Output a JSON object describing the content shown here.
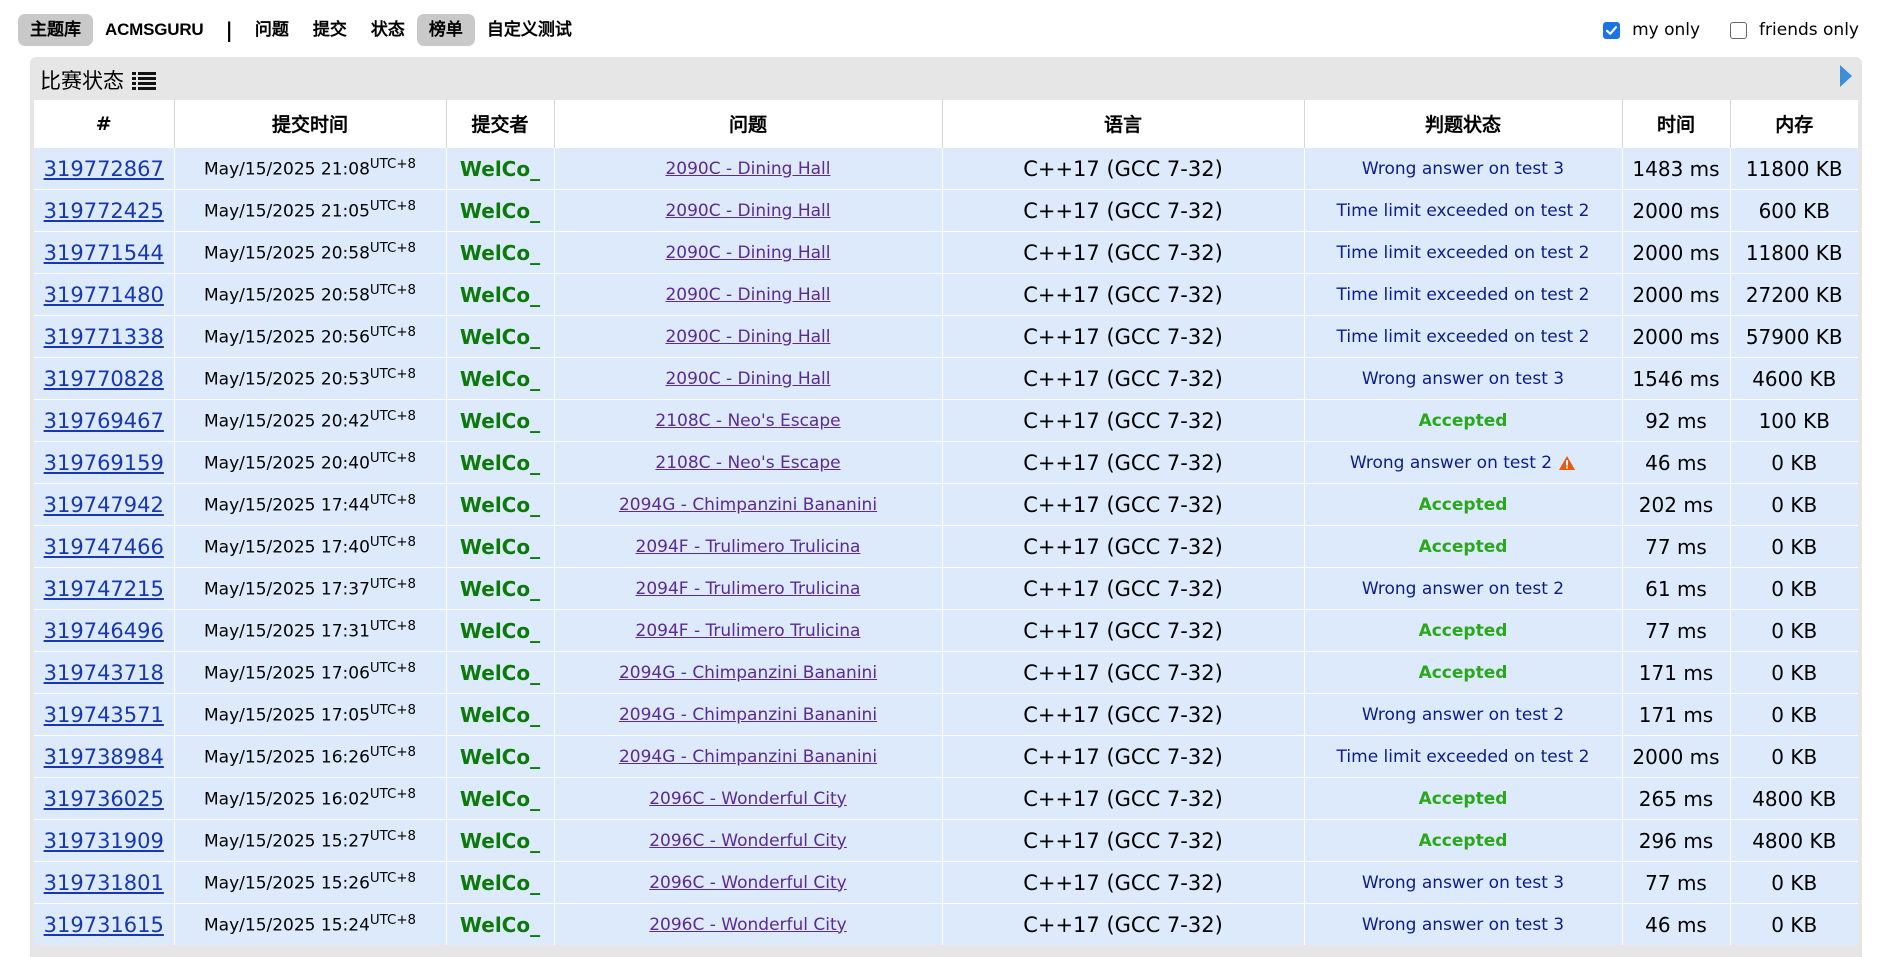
{
  "nav": {
    "items": [
      {
        "label": "主题库",
        "active": true
      },
      {
        "label": "ACMSGURU",
        "active": false
      },
      {
        "label": "问题",
        "active": false
      },
      {
        "label": "提交",
        "active": false
      },
      {
        "label": "状态",
        "active": false
      },
      {
        "label": "榜单",
        "active": true
      },
      {
        "label": "自定义测试",
        "active": false
      }
    ],
    "separator": "|"
  },
  "filters": {
    "my_only": {
      "label": "my only",
      "checked": true
    },
    "friends_only": {
      "label": "friends only",
      "checked": false
    }
  },
  "panel": {
    "title": "比赛状态",
    "title_icon": "list-icon",
    "next_icon": "next-arrow-icon"
  },
  "table": {
    "headers": [
      "#",
      "提交时间",
      "提交者",
      "问题",
      "语言",
      "判题状态",
      "时间",
      "内存"
    ],
    "rows": [
      {
        "id": "319772867",
        "time": "May/15/2025 21:08",
        "tz": "UTC+8",
        "who": "WelCo_",
        "problem": "2090C - Dining Hall",
        "lang": "C++17 (GCC 7-32)",
        "verdict": "Wrong answer on test 3",
        "ok": false,
        "warn": false,
        "ms": "1483 ms",
        "mem": "11800 KB"
      },
      {
        "id": "319772425",
        "time": "May/15/2025 21:05",
        "tz": "UTC+8",
        "who": "WelCo_",
        "problem": "2090C - Dining Hall",
        "lang": "C++17 (GCC 7-32)",
        "verdict": "Time limit exceeded on test 2",
        "ok": false,
        "warn": false,
        "ms": "2000 ms",
        "mem": "600 KB"
      },
      {
        "id": "319771544",
        "time": "May/15/2025 20:58",
        "tz": "UTC+8",
        "who": "WelCo_",
        "problem": "2090C - Dining Hall",
        "lang": "C++17 (GCC 7-32)",
        "verdict": "Time limit exceeded on test 2",
        "ok": false,
        "warn": false,
        "ms": "2000 ms",
        "mem": "11800 KB"
      },
      {
        "id": "319771480",
        "time": "May/15/2025 20:58",
        "tz": "UTC+8",
        "who": "WelCo_",
        "problem": "2090C - Dining Hall",
        "lang": "C++17 (GCC 7-32)",
        "verdict": "Time limit exceeded on test 2",
        "ok": false,
        "warn": false,
        "ms": "2000 ms",
        "mem": "27200 KB"
      },
      {
        "id": "319771338",
        "time": "May/15/2025 20:56",
        "tz": "UTC+8",
        "who": "WelCo_",
        "problem": "2090C - Dining Hall",
        "lang": "C++17 (GCC 7-32)",
        "verdict": "Time limit exceeded on test 2",
        "ok": false,
        "warn": false,
        "ms": "2000 ms",
        "mem": "57900 KB"
      },
      {
        "id": "319770828",
        "time": "May/15/2025 20:53",
        "tz": "UTC+8",
        "who": "WelCo_",
        "problem": "2090C - Dining Hall",
        "lang": "C++17 (GCC 7-32)",
        "verdict": "Wrong answer on test 3",
        "ok": false,
        "warn": false,
        "ms": "1546 ms",
        "mem": "4600 KB"
      },
      {
        "id": "319769467",
        "time": "May/15/2025 20:42",
        "tz": "UTC+8",
        "who": "WelCo_",
        "problem": "2108C - Neo's Escape",
        "lang": "C++17 (GCC 7-32)",
        "verdict": "Accepted",
        "ok": true,
        "warn": false,
        "ms": "92 ms",
        "mem": "100 KB"
      },
      {
        "id": "319769159",
        "time": "May/15/2025 20:40",
        "tz": "UTC+8",
        "who": "WelCo_",
        "problem": "2108C - Neo's Escape",
        "lang": "C++17 (GCC 7-32)",
        "verdict": "Wrong answer on test 2",
        "ok": false,
        "warn": true,
        "ms": "46 ms",
        "mem": "0 KB"
      },
      {
        "id": "319747942",
        "time": "May/15/2025 17:44",
        "tz": "UTC+8",
        "who": "WelCo_",
        "problem": "2094G - Chimpanzini Bananini",
        "lang": "C++17 (GCC 7-32)",
        "verdict": "Accepted",
        "ok": true,
        "warn": false,
        "ms": "202 ms",
        "mem": "0 KB"
      },
      {
        "id": "319747466",
        "time": "May/15/2025 17:40",
        "tz": "UTC+8",
        "who": "WelCo_",
        "problem": "2094F - Trulimero Trulicina",
        "lang": "C++17 (GCC 7-32)",
        "verdict": "Accepted",
        "ok": true,
        "warn": false,
        "ms": "77 ms",
        "mem": "0 KB"
      },
      {
        "id": "319747215",
        "time": "May/15/2025 17:37",
        "tz": "UTC+8",
        "who": "WelCo_",
        "problem": "2094F - Trulimero Trulicina",
        "lang": "C++17 (GCC 7-32)",
        "verdict": "Wrong answer on test 2",
        "ok": false,
        "warn": false,
        "ms": "61 ms",
        "mem": "0 KB"
      },
      {
        "id": "319746496",
        "time": "May/15/2025 17:31",
        "tz": "UTC+8",
        "who": "WelCo_",
        "problem": "2094F - Trulimero Trulicina",
        "lang": "C++17 (GCC 7-32)",
        "verdict": "Accepted",
        "ok": true,
        "warn": false,
        "ms": "77 ms",
        "mem": "0 KB"
      },
      {
        "id": "319743718",
        "time": "May/15/2025 17:06",
        "tz": "UTC+8",
        "who": "WelCo_",
        "problem": "2094G - Chimpanzini Bananini",
        "lang": "C++17 (GCC 7-32)",
        "verdict": "Accepted",
        "ok": true,
        "warn": false,
        "ms": "171 ms",
        "mem": "0 KB"
      },
      {
        "id": "319743571",
        "time": "May/15/2025 17:05",
        "tz": "UTC+8",
        "who": "WelCo_",
        "problem": "2094G - Chimpanzini Bananini",
        "lang": "C++17 (GCC 7-32)",
        "verdict": "Wrong answer on test 2",
        "ok": false,
        "warn": false,
        "ms": "171 ms",
        "mem": "0 KB"
      },
      {
        "id": "319738984",
        "time": "May/15/2025 16:26",
        "tz": "UTC+8",
        "who": "WelCo_",
        "problem": "2094G - Chimpanzini Bananini",
        "lang": "C++17 (GCC 7-32)",
        "verdict": "Time limit exceeded on test 2",
        "ok": false,
        "warn": false,
        "ms": "2000 ms",
        "mem": "0 KB"
      },
      {
        "id": "319736025",
        "time": "May/15/2025 16:02",
        "tz": "UTC+8",
        "who": "WelCo_",
        "problem": "2096C - Wonderful City",
        "lang": "C++17 (GCC 7-32)",
        "verdict": "Accepted",
        "ok": true,
        "warn": false,
        "ms": "265 ms",
        "mem": "4800 KB"
      },
      {
        "id": "319731909",
        "time": "May/15/2025 15:27",
        "tz": "UTC+8",
        "who": "WelCo_",
        "problem": "2096C - Wonderful City",
        "lang": "C++17 (GCC 7-32)",
        "verdict": "Accepted",
        "ok": true,
        "warn": false,
        "ms": "296 ms",
        "mem": "4800 KB"
      },
      {
        "id": "319731801",
        "time": "May/15/2025 15:26",
        "tz": "UTC+8",
        "who": "WelCo_",
        "problem": "2096C - Wonderful City",
        "lang": "C++17 (GCC 7-32)",
        "verdict": "Wrong answer on test 3",
        "ok": false,
        "warn": false,
        "ms": "77 ms",
        "mem": "0 KB"
      },
      {
        "id": "319731615",
        "time": "May/15/2025 15:24",
        "tz": "UTC+8",
        "who": "WelCo_",
        "problem": "2096C - Wonderful City",
        "lang": "C++17 (GCC 7-32)",
        "verdict": "Wrong answer on test 3",
        "ok": false,
        "warn": false,
        "ms": "46 ms",
        "mem": "0 KB"
      }
    ]
  },
  "colors": {
    "row_bg": "#ddeafc",
    "link_blue": "#1838b0",
    "problem_purple": "#5c2a92",
    "user_green": "#0b7a0b",
    "accepted_green": "#2aa81b",
    "verdict_blue": "#0b1d8a",
    "checkbox_blue": "#1a73e8",
    "warning_orange": "#e8590c"
  }
}
